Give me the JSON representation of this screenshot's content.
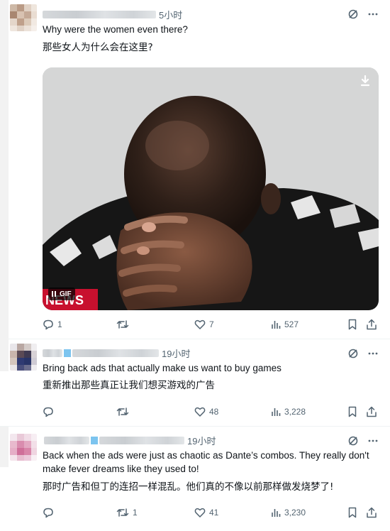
{
  "tweets": [
    {
      "time": "5小时",
      "text_en": "Why were the women even there?",
      "text_zh": "那些女人为什么会在这里?",
      "media": {
        "badge": "GIF",
        "news_label": "NEWS"
      },
      "replies": "1",
      "reposts": "",
      "likes": "7",
      "views": "527"
    },
    {
      "time": "19小时",
      "text_en": "Bring back ads that actually make us want to buy games",
      "text_zh": "重新推出那些真正让我们想买游戏的广告",
      "replies": "",
      "reposts": "",
      "likes": "48",
      "views": "3,228"
    },
    {
      "time": "19小时",
      "text_en": "Back when the ads were just as chaotic as Dante’s combos. They really don't make fever dreams like they used to!",
      "text_zh": "那时广告和但丁的连招一样混乱。他们真的不像以前那样做发烧梦了!",
      "replies": "",
      "reposts": "1",
      "likes": "41",
      "views": "3,230"
    }
  ],
  "icons": [
    "grok-icon",
    "more-icon",
    "reply-icon",
    "repost-icon",
    "like-icon",
    "views-icon",
    "bookmark-icon",
    "share-icon",
    "download-icon",
    "pause-icon"
  ],
  "colors": {
    "icon_gray": "#536471",
    "news_red": "#c8102e",
    "blur_blue": "#7cc4ef"
  }
}
